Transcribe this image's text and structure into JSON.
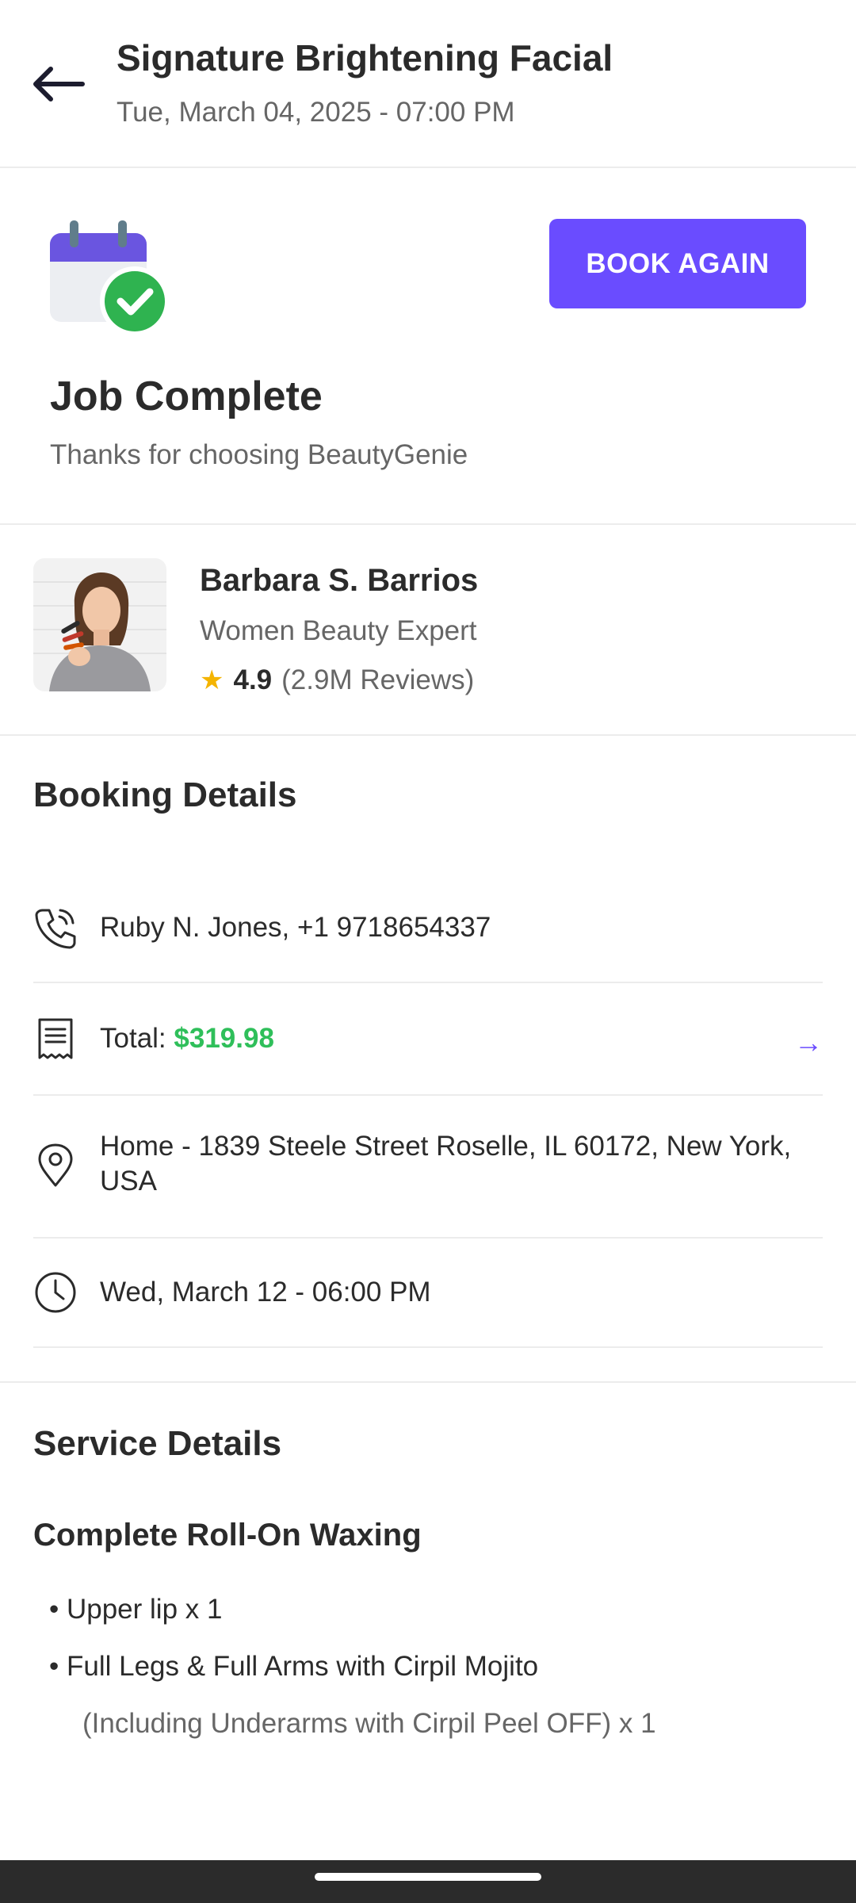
{
  "header": {
    "title": "Signature Brightening Facial",
    "subtitle": "Tue, March 04, 2025 - 07:00 PM",
    "back_icon": "arrow-left-icon"
  },
  "status": {
    "icon": "calendar-check-icon",
    "title": "Job Complete",
    "subtitle": "Thanks for choosing BeautyGenie",
    "book_again_label": "BOOK AGAIN",
    "accent_color": "#6a4cff",
    "success_color": "#2fb350"
  },
  "expert": {
    "name": "Barbara S. Barrios",
    "role": "Women Beauty Expert",
    "rating": "4.9",
    "reviews": "(2.9M Reviews)"
  },
  "booking": {
    "title": "Booking Details",
    "contact": "Ruby N. Jones, +1 9718654337",
    "total_label": "Total: ",
    "total_value": "$319.98",
    "address": "Home - 1839 Steele Street Roselle, IL 60172, New York, USA",
    "datetime": "Wed, March 12 - 06:00 PM",
    "arrow": "→"
  },
  "service": {
    "title": "Service Details",
    "package": "Complete Roll-On Waxing",
    "items": [
      "• Upper lip x 1",
      "• Full Legs & Full Arms with Cirpil Mojito"
    ],
    "note": "(Including Underarms with Cirpil Peel OFF) x 1"
  }
}
